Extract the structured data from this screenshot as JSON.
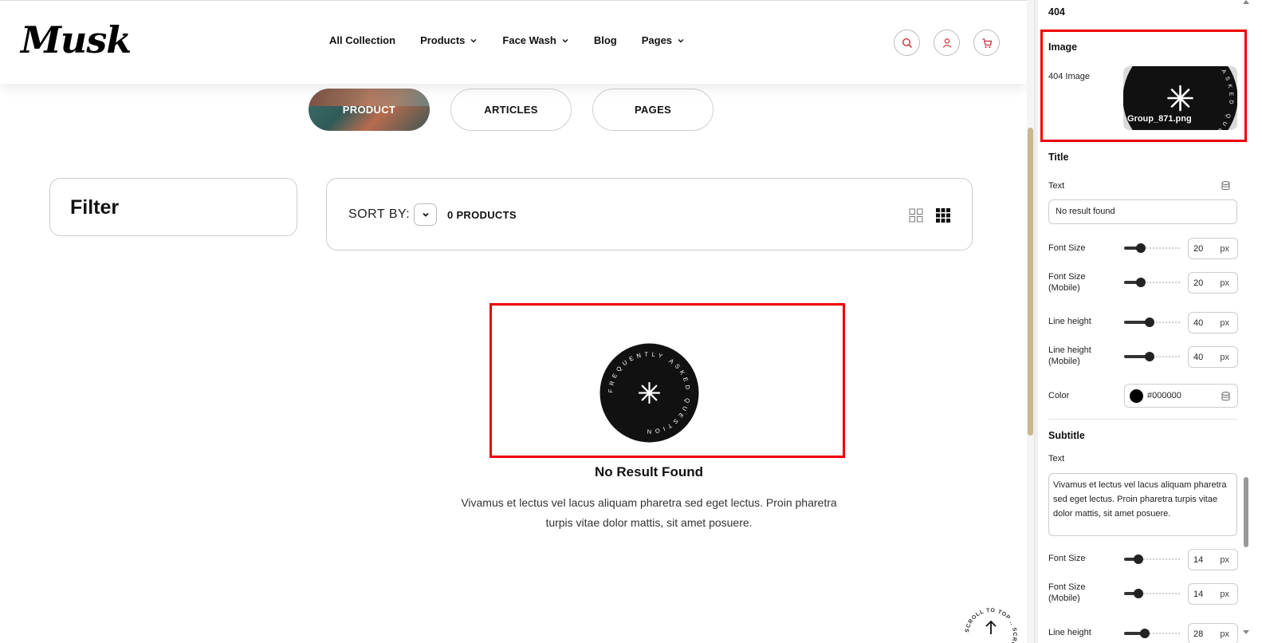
{
  "header": {
    "logo": "Musk",
    "nav": [
      {
        "label": "All Collection",
        "has_dropdown": false
      },
      {
        "label": "Products",
        "has_dropdown": true
      },
      {
        "label": "Face Wash",
        "has_dropdown": true
      },
      {
        "label": "Blog",
        "has_dropdown": false
      },
      {
        "label": "Pages",
        "has_dropdown": true
      }
    ],
    "icons": [
      "search-icon",
      "user-icon",
      "cart-icon"
    ],
    "accent_color": "#c8323c"
  },
  "search_tabs": [
    {
      "label": "PRODUCT",
      "active": true
    },
    {
      "label": "ARTICLES",
      "active": false
    },
    {
      "label": "PAGES",
      "active": false
    }
  ],
  "filter": {
    "label": "Filter"
  },
  "toolbar": {
    "sort_label": "SORT BY:",
    "product_count": "0 PRODUCTS",
    "view_icons": [
      "grid-2-icon",
      "grid-3-icon"
    ]
  },
  "not_found": {
    "emblem_text": "FREQUENTLY ASKED QUESTION",
    "title": "No Result Found",
    "subtitle": "Vivamus et lectus vel lacus aliquam pharetra sed eget lectus. Proin pharetra turpis vitae dolor mattis, sit amet posuere."
  },
  "scroll_top": {
    "text": "SCROLL TO TOP .. SCROLL TO TOP .."
  },
  "panel": {
    "top_value": "404",
    "image_section": {
      "heading": "Image",
      "label": "404 Image",
      "filename": "Group_871.png"
    },
    "title_section": {
      "heading": "Title",
      "text_label": "Text",
      "text_value": "No result found",
      "font_size": {
        "label": "Font Size",
        "value": "20",
        "unit": "px",
        "slider": 0.25
      },
      "font_size_mobile": {
        "label": "Font Size (Mobile)",
        "value": "20",
        "unit": "px",
        "slider": 0.25
      },
      "line_height": {
        "label": "Line height",
        "value": "40",
        "unit": "px",
        "slider": 0.43
      },
      "line_height_mobile": {
        "label": "Line height (Mobile)",
        "value": "40",
        "unit": "px",
        "slider": 0.43
      },
      "color": {
        "label": "Color",
        "value": "#000000"
      }
    },
    "subtitle_section": {
      "heading": "Subtitle",
      "text_label": "Text",
      "text_value": "Vivamus et lectus vel lacus aliquam pharetra sed eget lectus. Proin pharetra turpis vitae dolor mattis, sit amet posuere.",
      "font_size": {
        "label": "Font Size",
        "value": "14",
        "unit": "px",
        "slider": 0.2
      },
      "font_size_mobile": {
        "label": "Font Size (Mobile)",
        "value": "14",
        "unit": "px",
        "slider": 0.2
      },
      "line_height": {
        "label": "Line height",
        "value": "28",
        "unit": "px",
        "slider": 0.33
      }
    }
  }
}
